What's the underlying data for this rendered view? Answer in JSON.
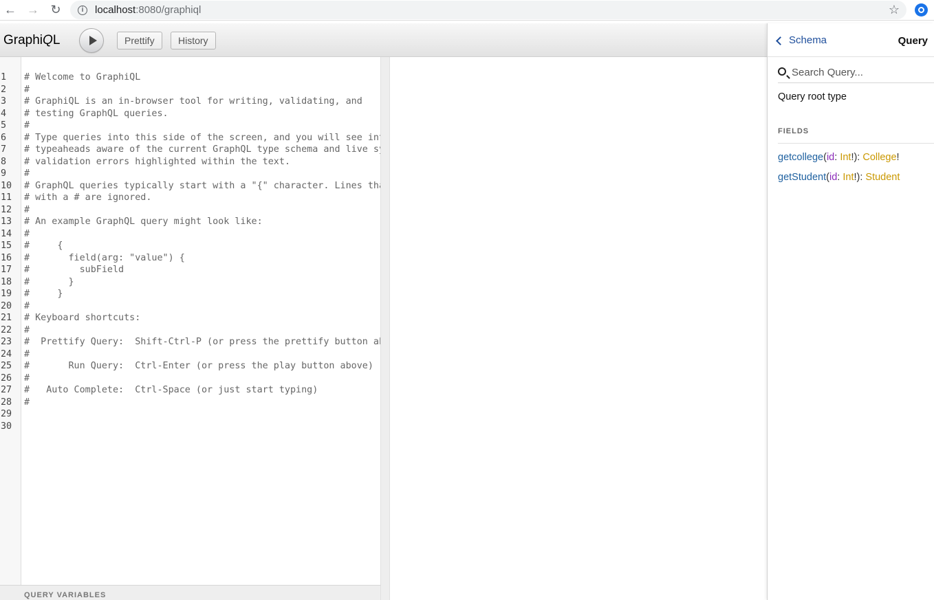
{
  "browser": {
    "url_host": "localhost",
    "url_rest": ":8080/graphiql"
  },
  "toolbar": {
    "logo_a": "Graphi",
    "logo_b": "Q",
    "logo_c": "L",
    "prettify_label": "Prettify",
    "history_label": "History"
  },
  "editor": {
    "lines": [
      {
        "n": "1",
        "text": "# Welcome to GraphiQL"
      },
      {
        "n": "2",
        "text": "#"
      },
      {
        "n": "3",
        "text": "# GraphiQL is an in-browser tool for writing, validating, and"
      },
      {
        "n": "4",
        "text": "# testing GraphQL queries."
      },
      {
        "n": "5",
        "text": "#"
      },
      {
        "n": "6",
        "text": "# Type queries into this side of the screen, and you will see int"
      },
      {
        "n": "7",
        "text": "# typeaheads aware of the current GraphQL type schema and live sy"
      },
      {
        "n": "8",
        "text": "# validation errors highlighted within the text."
      },
      {
        "n": "9",
        "text": "#"
      },
      {
        "n": "10",
        "text": "# GraphQL queries typically start with a \"{\" character. Lines tha"
      },
      {
        "n": "11",
        "text": "# with a # are ignored."
      },
      {
        "n": "12",
        "text": "#"
      },
      {
        "n": "13",
        "text": "# An example GraphQL query might look like:"
      },
      {
        "n": "14",
        "text": "#"
      },
      {
        "n": "15",
        "text": "#     {"
      },
      {
        "n": "16",
        "text": "#       field(arg: \"value\") {"
      },
      {
        "n": "17",
        "text": "#         subField"
      },
      {
        "n": "18",
        "text": "#       }"
      },
      {
        "n": "19",
        "text": "#     }"
      },
      {
        "n": "20",
        "text": "#"
      },
      {
        "n": "21",
        "text": "# Keyboard shortcuts:"
      },
      {
        "n": "22",
        "text": "#"
      },
      {
        "n": "23",
        "text": "#  Prettify Query:  Shift-Ctrl-P (or press the prettify button ab"
      },
      {
        "n": "24",
        "text": "#"
      },
      {
        "n": "25",
        "text": "#       Run Query:  Ctrl-Enter (or press the play button above)"
      },
      {
        "n": "26",
        "text": "#"
      },
      {
        "n": "27",
        "text": "#   Auto Complete:  Ctrl-Space (or just start typing)"
      },
      {
        "n": "28",
        "text": "#"
      },
      {
        "n": "29",
        "text": ""
      },
      {
        "n": "30",
        "text": ""
      }
    ],
    "variables_label": "QUERY VARIABLES"
  },
  "docs": {
    "back_label": "Schema",
    "heading": "Query",
    "search_placeholder": "Search Query...",
    "description": "Query root type",
    "fields_label": "FIELDS",
    "fields": [
      {
        "name": "getcollege",
        "arg": "id",
        "arg_type": "Int",
        "arg_suffix": "!",
        "type": "College",
        "type_suffix": "!"
      },
      {
        "name": "getStudent",
        "arg": "id",
        "arg_type": "Int",
        "arg_suffix": "!",
        "type": "Student",
        "type_suffix": ""
      }
    ]
  },
  "colors": {
    "field_name": "#1f61a0",
    "arg_name": "#8b2bb9",
    "type_name": "#ca9800",
    "link": "#1f4f9c"
  }
}
